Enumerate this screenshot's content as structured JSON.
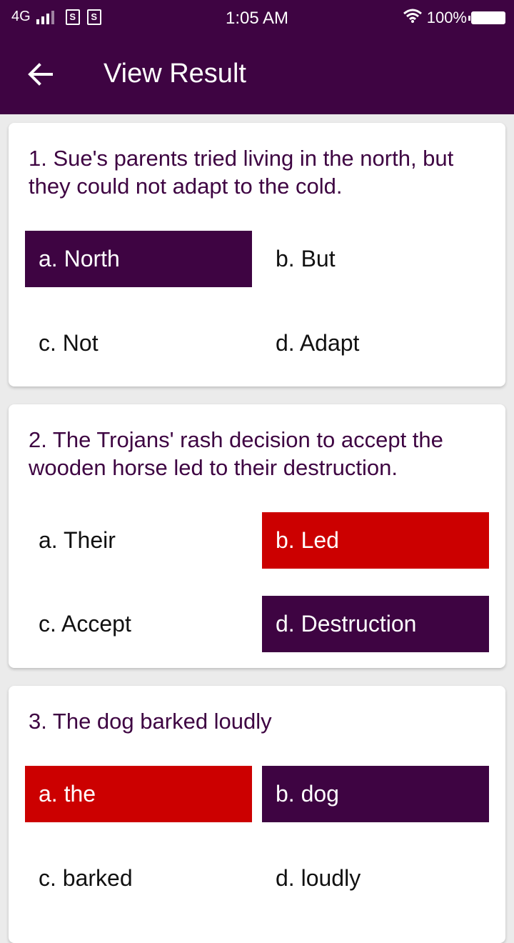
{
  "status_bar": {
    "network": "4G",
    "time": "1:05 AM",
    "battery": "100%"
  },
  "app_bar": {
    "title": "View Result",
    "back_icon": "arrow-left-icon"
  },
  "colors": {
    "primary": "#3e0442",
    "wrong": "#cc0000",
    "background": "#ebebeb"
  },
  "questions": [
    {
      "text": "1. Sue's parents tried living in the north, but they could not adapt to the cold.",
      "options": [
        {
          "label": "a. North",
          "state": "selected"
        },
        {
          "label": "b. But",
          "state": "none"
        },
        {
          "label": "c. Not",
          "state": "none"
        },
        {
          "label": "d. Adapt",
          "state": "none"
        }
      ]
    },
    {
      "text": "2. The Trojans' rash decision to accept the wooden horse led to their destruction.",
      "options": [
        {
          "label": "a. Their",
          "state": "none"
        },
        {
          "label": "b. Led",
          "state": "wrong"
        },
        {
          "label": "c. Accept",
          "state": "none"
        },
        {
          "label": "d. Destruction",
          "state": "selected"
        }
      ]
    },
    {
      "text": "3. The dog barked loudly",
      "options": [
        {
          "label": "a. the",
          "state": "wrong"
        },
        {
          "label": "b. dog",
          "state": "selected"
        },
        {
          "label": "c. barked",
          "state": "none"
        },
        {
          "label": "d. loudly",
          "state": "none"
        }
      ]
    }
  ]
}
